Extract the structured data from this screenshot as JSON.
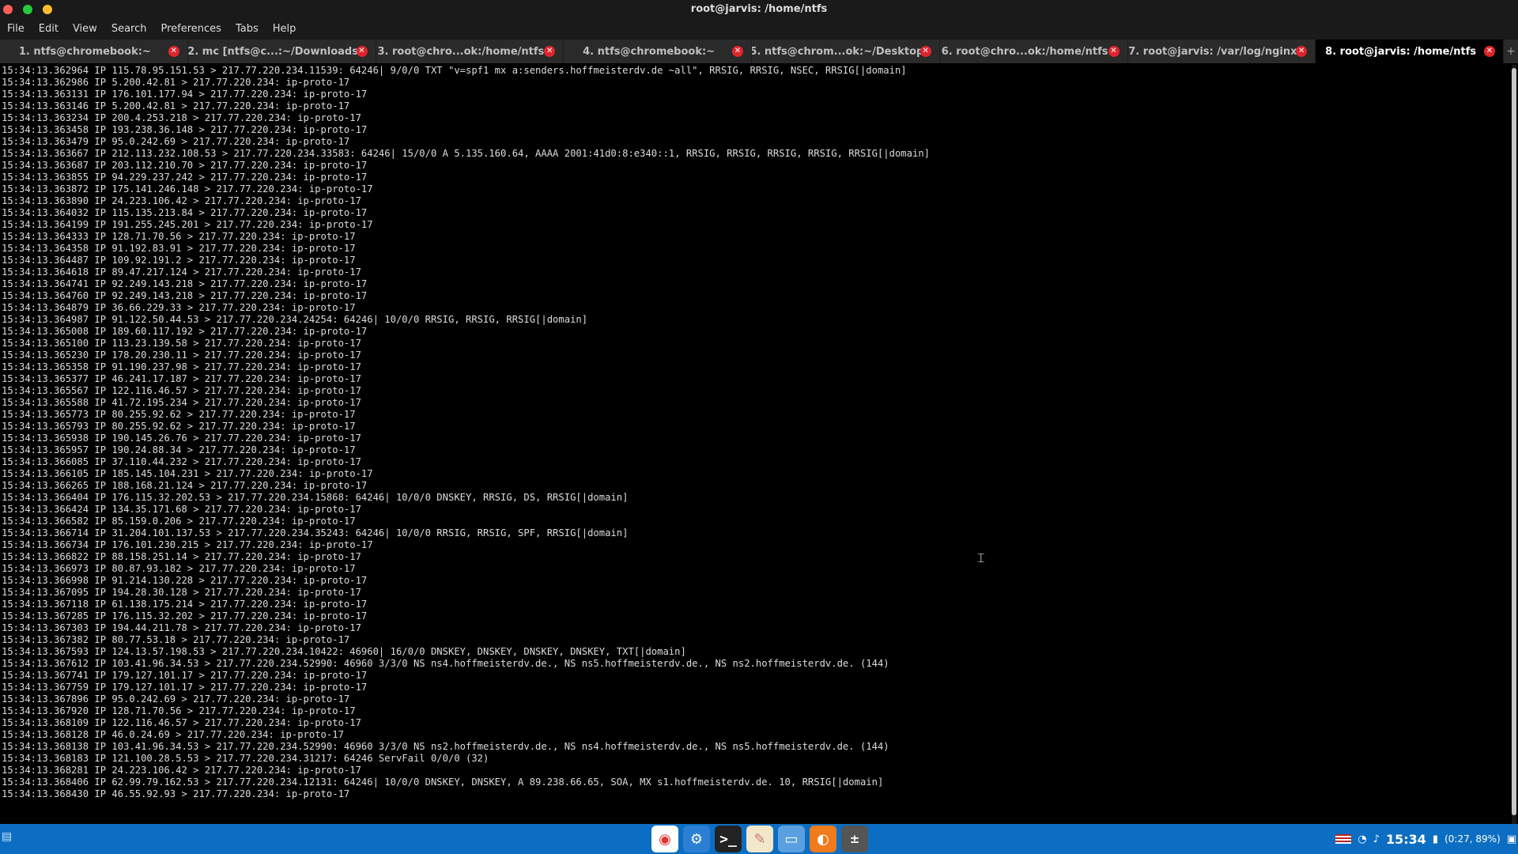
{
  "window": {
    "title": "root@jarvis: /home/ntfs"
  },
  "menu": [
    "File",
    "Edit",
    "View",
    "Search",
    "Preferences",
    "Tabs",
    "Help"
  ],
  "tabs": [
    {
      "label": "1. ntfs@chromebook:~",
      "active": false
    },
    {
      "label": "2. mc [ntfs@c...:~/Downloads",
      "active": false
    },
    {
      "label": "3. root@chro...ok:/home/ntfs",
      "active": false
    },
    {
      "label": "4. ntfs@chromebook:~",
      "active": false
    },
    {
      "label": "5. ntfs@chrom...ok:~/Desktop",
      "active": false
    },
    {
      "label": "6. root@chro...ok:/home/ntfs",
      "active": false
    },
    {
      "label": "7. root@jarvis: /var/log/nginx",
      "active": false
    },
    {
      "label": "8. root@jarvis: /home/ntfs",
      "active": true
    }
  ],
  "terminal_lines": [
    "15:34:13.362964 IP 115.78.95.151.53 > 217.77.220.234.11539: 64246| 9/0/0 TXT \"v=spf1 mx a:senders.hoffmeisterdv.de ~all\", RRSIG, RRSIG, NSEC, RRSIG[|domain]",
    "15:34:13.362986 IP 5.200.42.81 > 217.77.220.234: ip-proto-17",
    "15:34:13.363131 IP 176.101.177.94 > 217.77.220.234: ip-proto-17",
    "15:34:13.363146 IP 5.200.42.81 > 217.77.220.234: ip-proto-17",
    "15:34:13.363234 IP 200.4.253.218 > 217.77.220.234: ip-proto-17",
    "15:34:13.363458 IP 193.238.36.148 > 217.77.220.234: ip-proto-17",
    "15:34:13.363479 IP 95.0.242.69 > 217.77.220.234: ip-proto-17",
    "15:34:13.363667 IP 212.113.232.108.53 > 217.77.220.234.33583: 64246| 15/0/0 A 5.135.160.64, AAAA 2001:41d0:8:e340::1, RRSIG, RRSIG, RRSIG, RRSIG, RRSIG[|domain]",
    "15:34:13.363687 IP 203.112.210.70 > 217.77.220.234: ip-proto-17",
    "15:34:13.363855 IP 94.229.237.242 > 217.77.220.234: ip-proto-17",
    "15:34:13.363872 IP 175.141.246.148 > 217.77.220.234: ip-proto-17",
    "15:34:13.363890 IP 24.223.106.42 > 217.77.220.234: ip-proto-17",
    "15:34:13.364032 IP 115.135.213.84 > 217.77.220.234: ip-proto-17",
    "15:34:13.364199 IP 191.255.245.201 > 217.77.220.234: ip-proto-17",
    "15:34:13.364333 IP 128.71.70.56 > 217.77.220.234: ip-proto-17",
    "15:34:13.364358 IP 91.192.83.91 > 217.77.220.234: ip-proto-17",
    "15:34:13.364487 IP 109.92.191.2 > 217.77.220.234: ip-proto-17",
    "15:34:13.364618 IP 89.47.217.124 > 217.77.220.234: ip-proto-17",
    "15:34:13.364741 IP 92.249.143.218 > 217.77.220.234: ip-proto-17",
    "15:34:13.364760 IP 92.249.143.218 > 217.77.220.234: ip-proto-17",
    "15:34:13.364879 IP 36.66.229.33 > 217.77.220.234: ip-proto-17",
    "15:34:13.364987 IP 91.122.50.44.53 > 217.77.220.234.24254: 64246| 10/0/0 RRSIG, RRSIG, RRSIG[|domain]",
    "15:34:13.365008 IP 189.60.117.192 > 217.77.220.234: ip-proto-17",
    "15:34:13.365100 IP 113.23.139.58 > 217.77.220.234: ip-proto-17",
    "15:34:13.365230 IP 178.20.230.11 > 217.77.220.234: ip-proto-17",
    "15:34:13.365358 IP 91.190.237.98 > 217.77.220.234: ip-proto-17",
    "15:34:13.365377 IP 46.241.17.187 > 217.77.220.234: ip-proto-17",
    "15:34:13.365567 IP 122.116.46.57 > 217.77.220.234: ip-proto-17",
    "15:34:13.365588 IP 41.72.195.234 > 217.77.220.234: ip-proto-17",
    "15:34:13.365773 IP 80.255.92.62 > 217.77.220.234: ip-proto-17",
    "15:34:13.365793 IP 80.255.92.62 > 217.77.220.234: ip-proto-17",
    "15:34:13.365938 IP 190.145.26.76 > 217.77.220.234: ip-proto-17",
    "15:34:13.365957 IP 190.24.88.34 > 217.77.220.234: ip-proto-17",
    "15:34:13.366085 IP 37.110.44.232 > 217.77.220.234: ip-proto-17",
    "15:34:13.366105 IP 185.145.104.231 > 217.77.220.234: ip-proto-17",
    "15:34:13.366265 IP 188.168.21.124 > 217.77.220.234: ip-proto-17",
    "15:34:13.366404 IP 176.115.32.202.53 > 217.77.220.234.15868: 64246| 10/0/0 DNSKEY, RRSIG, DS, RRSIG[|domain]",
    "15:34:13.366424 IP 134.35.171.68 > 217.77.220.234: ip-proto-17",
    "15:34:13.366582 IP 85.159.0.206 > 217.77.220.234: ip-proto-17",
    "15:34:13.366714 IP 31.204.101.137.53 > 217.77.220.234.35243: 64246| 10/0/0 RRSIG, RRSIG, SPF, RRSIG[|domain]",
    "15:34:13.366734 IP 176.101.230.215 > 217.77.220.234: ip-proto-17",
    "15:34:13.366822 IP 88.158.251.14 > 217.77.220.234: ip-proto-17",
    "15:34:13.366973 IP 80.87.93.182 > 217.77.220.234: ip-proto-17",
    "15:34:13.366998 IP 91.214.130.228 > 217.77.220.234: ip-proto-17",
    "15:34:13.367095 IP 194.28.30.128 > 217.77.220.234: ip-proto-17",
    "15:34:13.367118 IP 61.138.175.214 > 217.77.220.234: ip-proto-17",
    "15:34:13.367285 IP 176.115.32.202 > 217.77.220.234: ip-proto-17",
    "15:34:13.367303 IP 194.44.211.78 > 217.77.220.234: ip-proto-17",
    "15:34:13.367382 IP 80.77.53.18 > 217.77.220.234: ip-proto-17",
    "15:34:13.367593 IP 124.13.57.198.53 > 217.77.220.234.10422: 46960| 16/0/0 DNSKEY, DNSKEY, DNSKEY, DNSKEY, TXT[|domain]",
    "15:34:13.367612 IP 103.41.96.34.53 > 217.77.220.234.52990: 46960 3/3/0 NS ns4.hoffmeisterdv.de., NS ns5.hoffmeisterdv.de., NS ns2.hoffmeisterdv.de. (144)",
    "15:34:13.367741 IP 179.127.101.17 > 217.77.220.234: ip-proto-17",
    "15:34:13.367759 IP 179.127.101.17 > 217.77.220.234: ip-proto-17",
    "15:34:13.367896 IP 95.0.242.69 > 217.77.220.234: ip-proto-17",
    "15:34:13.367920 IP 128.71.70.56 > 217.77.220.234: ip-proto-17",
    "15:34:13.368109 IP 122.116.46.57 > 217.77.220.234: ip-proto-17",
    "15:34:13.368128 IP 46.0.24.69 > 217.77.220.234: ip-proto-17",
    "15:34:13.368138 IP 103.41.96.34.53 > 217.77.220.234.52990: 46960 3/3/0 NS ns2.hoffmeisterdv.de., NS ns4.hoffmeisterdv.de., NS ns5.hoffmeisterdv.de. (144)",
    "15:34:13.368183 IP 121.100.28.5.53 > 217.77.220.234.31217: 64246 ServFail 0/0/0 (32)",
    "15:34:13.368281 IP 24.223.106.42 > 217.77.220.234: ip-proto-17",
    "15:34:13.368406 IP 62.99.79.162.53 > 217.77.220.234.12131: 64246| 10/0/0 DNSKEY, DNSKEY, A 89.238.66.65, SOA, MX s1.hoffmeisterdv.de. 10, RRSIG[|domain]",
    "15:34:13.368430 IP 46.55.92.93 > 217.77.220.234: ip-proto-17"
  ],
  "taskbar": {
    "clock": "15:34",
    "battery": "(0:27, 89%)",
    "dock_icons": [
      "chrome-beta-icon",
      "settings-gear-icon",
      "terminal-icon",
      "notes-icon",
      "files-icon",
      "firefox-icon",
      "calculator-icon"
    ]
  },
  "colors": {
    "terminal_bg": "#000000",
    "terminal_fg": "#dcdcdc",
    "tab_close": "#e0242c",
    "taskbar": "#0c6ec2"
  }
}
